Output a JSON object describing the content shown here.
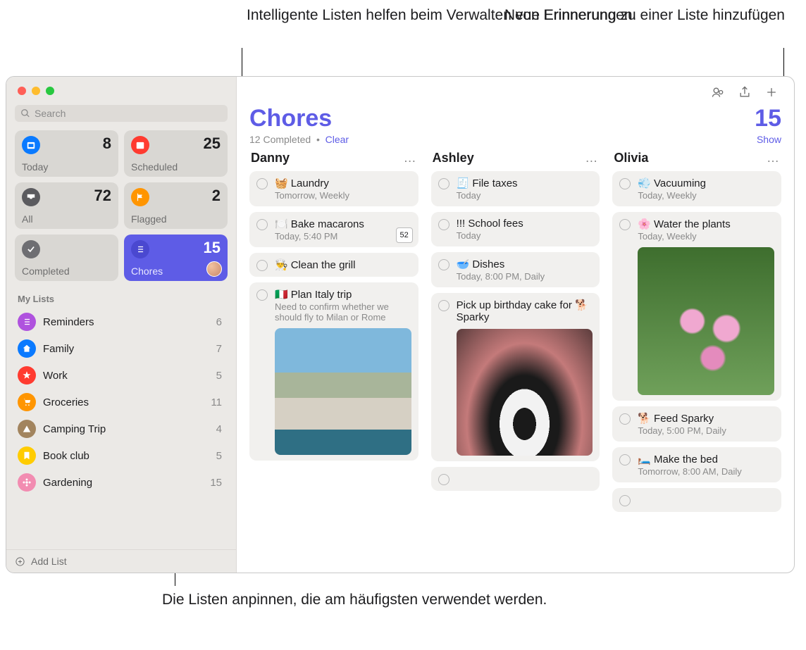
{
  "callouts": {
    "top_left": "Intelligente Listen helfen beim\nVerwalten von Erinnerungen.",
    "top_right": "Neue Erinnerung zu\neiner Liste hinzufügen",
    "bottom": "Die Listen anpinnen, die am\nhäufigsten verwendet werden."
  },
  "search": {
    "placeholder": "Search"
  },
  "smart": {
    "today": {
      "label": "Today",
      "count": "8",
      "color": "#0a7aff"
    },
    "scheduled": {
      "label": "Scheduled",
      "count": "25",
      "color": "#ff3b30"
    },
    "all": {
      "label": "All",
      "count": "72",
      "color": "#5b5b5f"
    },
    "flagged": {
      "label": "Flagged",
      "count": "2",
      "color": "#ff9500"
    },
    "completed": {
      "label": "Completed",
      "count": "",
      "color": "#6e6e72"
    },
    "chores": {
      "label": "Chores",
      "count": "15",
      "color": "#5e5ce6"
    }
  },
  "my_lists_title": "My Lists",
  "my_lists": [
    {
      "name": "Reminders",
      "count": "6",
      "color": "#af52de",
      "icon": "list"
    },
    {
      "name": "Family",
      "count": "7",
      "color": "#0a7aff",
      "icon": "home"
    },
    {
      "name": "Work",
      "count": "5",
      "color": "#ff3b30",
      "icon": "star"
    },
    {
      "name": "Groceries",
      "count": "11",
      "color": "#ff9500",
      "icon": "cart"
    },
    {
      "name": "Camping Trip",
      "count": "4",
      "color": "#a2845e",
      "icon": "tent"
    },
    {
      "name": "Book club",
      "count": "5",
      "color": "#ffcc00",
      "icon": "bookmark"
    },
    {
      "name": "Gardening",
      "count": "15",
      "color": "#f28cb1",
      "icon": "flower"
    }
  ],
  "add_list": "Add List",
  "header": {
    "title": "Chores",
    "count": "15",
    "completed": "12 Completed",
    "clear": "Clear",
    "show": "Show"
  },
  "columns": [
    {
      "name": "Danny",
      "items": [
        {
          "emoji": "🧺",
          "title": "Laundry",
          "sub": "Tomorrow, Weekly"
        },
        {
          "emoji": "🍽️",
          "title": "Bake macarons",
          "sub": "Today, 5:40 PM",
          "badge": "52"
        },
        {
          "emoji": "👨‍🍳",
          "title": "Clean the grill",
          "sub": ""
        },
        {
          "emoji": "🇮🇹",
          "title": "Plan Italy trip",
          "sub": "Need to confirm whether we should fly to Milan or Rome",
          "image": "italy"
        }
      ]
    },
    {
      "name": "Ashley",
      "items": [
        {
          "emoji": "🧾",
          "title": "File taxes",
          "sub": "Today"
        },
        {
          "emoji": "",
          "title": "!!! School fees",
          "sub": "Today"
        },
        {
          "emoji": "🥣",
          "title": "Dishes",
          "sub": "Today, 8:00 PM, Daily"
        },
        {
          "emoji": "",
          "title": "Pick up birthday cake for 🐕 Sparky",
          "sub": "",
          "image": "dog"
        }
      ],
      "empty_slot": true
    },
    {
      "name": "Olivia",
      "items": [
        {
          "emoji": "💨",
          "title": "Vacuuming",
          "sub": "Today, Weekly"
        },
        {
          "emoji": "🌸",
          "title": "Water the plants",
          "sub": "Today, Weekly",
          "image": "flower"
        },
        {
          "emoji": "🐕",
          "title": "Feed Sparky",
          "sub": "Today, 5:00 PM, Daily"
        },
        {
          "emoji": "🛏️",
          "title": "Make the bed",
          "sub": "Tomorrow, 8:00 AM, Daily"
        }
      ],
      "empty_slot": true
    }
  ]
}
